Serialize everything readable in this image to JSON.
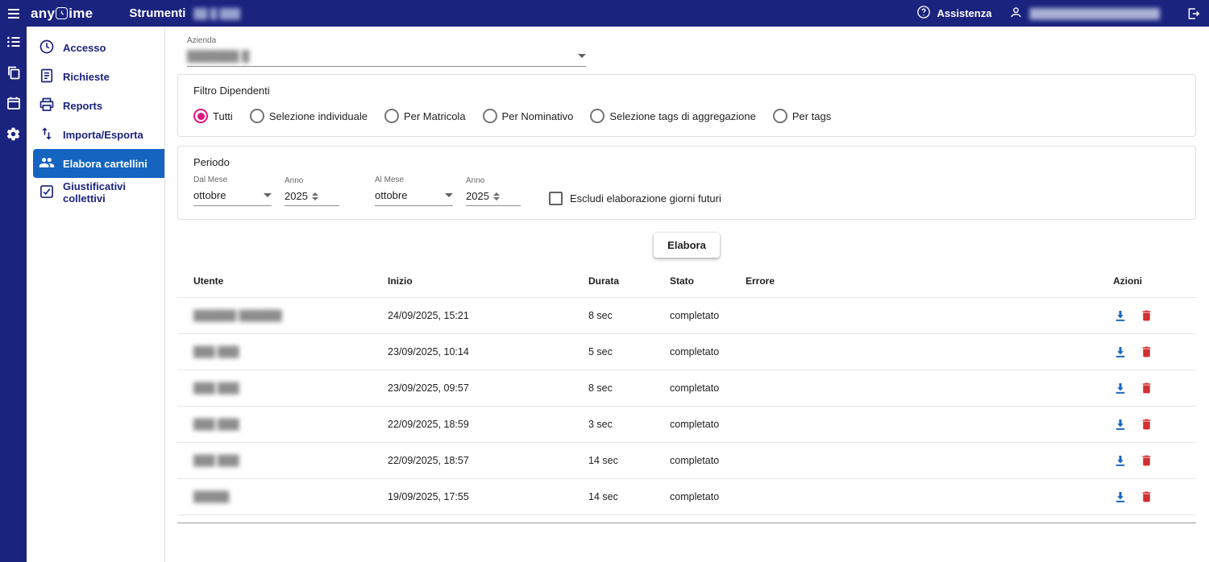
{
  "header": {
    "logo_prefix": "any",
    "logo_suffix": "ime",
    "title": "Strumenti",
    "title_badge": "██ █ ███",
    "assistance": "Assistenza",
    "user": "███████████████████"
  },
  "sidebar": {
    "items": [
      {
        "label": "Accesso"
      },
      {
        "label": "Richieste"
      },
      {
        "label": "Reports"
      },
      {
        "label": "Importa/Esporta"
      },
      {
        "label": "Elabora cartellini",
        "active": true
      },
      {
        "label": "Giustificativi collettivi"
      }
    ]
  },
  "azienda": {
    "label": "Azienda",
    "value": "███████ █"
  },
  "filtro": {
    "title": "Filtro Dipendenti",
    "options": [
      {
        "label": "Tutti",
        "selected": true
      },
      {
        "label": "Selezione individuale",
        "selected": false
      },
      {
        "label": "Per Matricola",
        "selected": false
      },
      {
        "label": "Per Nominativo",
        "selected": false
      },
      {
        "label": "Selezione tags di aggregazione",
        "selected": false
      },
      {
        "label": "Per tags",
        "selected": false
      }
    ]
  },
  "periodo": {
    "title": "Periodo",
    "dal_mese": {
      "label": "Dal Mese",
      "value": "ottobre"
    },
    "anno_da": {
      "label": "Anno",
      "value": "2025"
    },
    "al_mese": {
      "label": "Al Mese",
      "value": "ottobre"
    },
    "anno_a": {
      "label": "Anno",
      "value": "2025"
    },
    "escludi": {
      "label": "Escludi elaborazione giorni futuri",
      "checked": false
    }
  },
  "actions": {
    "elabora": "Elabora"
  },
  "table": {
    "columns": [
      "Utente",
      "Inizio",
      "Durata",
      "Stato",
      "Errore",
      "Azioni"
    ],
    "rows": [
      {
        "utente": "██████ ██████",
        "inizio": "24/09/2025, 15:21",
        "durata": "8 sec",
        "stato": "completato",
        "errore": ""
      },
      {
        "utente": "███ ███",
        "inizio": "23/09/2025, 10:14",
        "durata": "5 sec",
        "stato": "completato",
        "errore": ""
      },
      {
        "utente": "███ ███",
        "inizio": "23/09/2025, 09:57",
        "durata": "8 sec",
        "stato": "completato",
        "errore": ""
      },
      {
        "utente": "███ ███",
        "inizio": "22/09/2025, 18:59",
        "durata": "3 sec",
        "stato": "completato",
        "errore": ""
      },
      {
        "utente": "███ ███",
        "inizio": "22/09/2025, 18:57",
        "durata": "14 sec",
        "stato": "completato",
        "errore": ""
      },
      {
        "utente": "█████",
        "inizio": "19/09/2025, 17:55",
        "durata": "14 sec",
        "stato": "completato",
        "errore": ""
      }
    ]
  },
  "colors": {
    "header_bg": "#1a237e",
    "active_item_bg": "#1565c0",
    "radio_accent": "#e2147d",
    "download_icon": "#1565c0",
    "delete_icon": "#d32f2f"
  }
}
